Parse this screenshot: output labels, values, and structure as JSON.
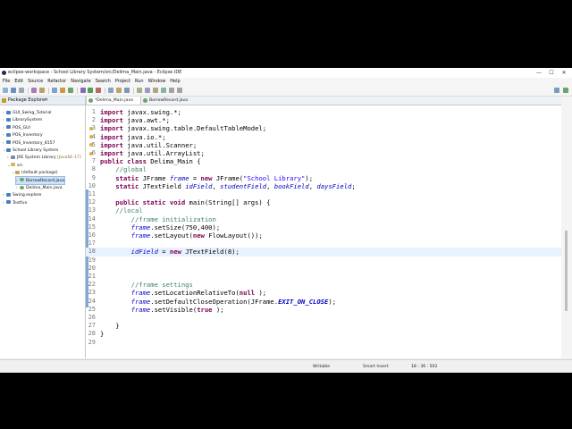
{
  "window": {
    "title": "eclipse-workspace - School Library System/src/Delima_Main.java - Eclipse IDE",
    "min_glyph": "—",
    "max_glyph": "☐",
    "close_glyph": "✕"
  },
  "menu": [
    "File",
    "Edit",
    "Source",
    "Refactor",
    "Navigate",
    "Search",
    "Project",
    "Run",
    "Window",
    "Help"
  ],
  "package_explorer": {
    "tab_label": "Package Explorer",
    "close_glyph": "✕",
    "tree": [
      {
        "label": "GUI_Swing_Tutorial",
        "suffix": "",
        "icon": "project-icon",
        "indent": 0,
        "twisty": "›",
        "selected": false
      },
      {
        "label": "LibrarySystem",
        "suffix": "",
        "icon": "project-icon",
        "indent": 0,
        "twisty": "›",
        "selected": false
      },
      {
        "label": "POS_GUI",
        "suffix": "",
        "icon": "project-icon",
        "indent": 0,
        "twisty": "›",
        "selected": false
      },
      {
        "label": "POS_Inventory",
        "suffix": "",
        "icon": "project-icon",
        "indent": 0,
        "twisty": "›",
        "selected": false
      },
      {
        "label": "POS_Inventory_8157",
        "suffix": "",
        "icon": "project-icon",
        "indent": 0,
        "twisty": "›",
        "selected": false
      },
      {
        "label": "School Library System",
        "suffix": "",
        "icon": "project-icon",
        "indent": 0,
        "twisty": "⌄",
        "selected": false
      },
      {
        "label": "JRE System Library",
        "suffix": " [JavaSE-17]",
        "icon": "library-icon",
        "indent": 1,
        "twisty": "›",
        "selected": false
      },
      {
        "label": "src",
        "suffix": "",
        "icon": "source-folder-icon",
        "indent": 1,
        "twisty": "⌄",
        "selected": false
      },
      {
        "label": "(default package)",
        "suffix": "",
        "icon": "package-icon",
        "indent": 2,
        "twisty": "⌄",
        "selected": false
      },
      {
        "label": "BorrowRecord.java",
        "suffix": "",
        "icon": "java-file-icon",
        "indent": 3,
        "twisty": "›",
        "selected": true
      },
      {
        "label": "Delima_Main.java",
        "suffix": "",
        "icon": "java-file-icon",
        "indent": 3,
        "twisty": "›",
        "selected": false
      },
      {
        "label": "Swing.explore",
        "suffix": "",
        "icon": "project-icon",
        "indent": 0,
        "twisty": "›",
        "selected": false
      },
      {
        "label": "Testfun",
        "suffix": "",
        "icon": "project-icon",
        "indent": 0,
        "twisty": "›",
        "selected": false
      }
    ]
  },
  "editor": {
    "tabs": [
      {
        "label": "*Delima_Main.java",
        "active": true
      },
      {
        "label": "BorrowRecord.java",
        "active": false
      }
    ],
    "current_line": 18,
    "lines": [
      {
        "n": "1",
        "marker": false,
        "tokens": [
          [
            "kw",
            "import"
          ],
          [
            "",
            "javax.swing.*;"
          ]
        ]
      },
      {
        "n": "2",
        "marker": false,
        "tokens": [
          [
            "kw",
            "import"
          ],
          [
            "",
            "java.awt.*;"
          ]
        ]
      },
      {
        "n": "3",
        "marker": true,
        "tokens": [
          [
            "kw",
            "import"
          ],
          [
            "",
            "javax.swing.table.DefaultTableModel;"
          ]
        ]
      },
      {
        "n": "4",
        "marker": true,
        "tokens": [
          [
            "kw",
            "import"
          ],
          [
            "",
            "java.io.*;"
          ]
        ]
      },
      {
        "n": "5",
        "marker": true,
        "tokens": [
          [
            "kw",
            "import"
          ],
          [
            "",
            "java.util.Scanner;"
          ]
        ]
      },
      {
        "n": "6",
        "marker": true,
        "tokens": [
          [
            "kw",
            "import"
          ],
          [
            "",
            "java.util.ArrayList;"
          ]
        ]
      },
      {
        "n": "7",
        "marker": false,
        "tokens": [
          [
            "kw",
            "public class"
          ],
          [
            "",
            "Delima_Main {"
          ]
        ]
      },
      {
        "n": "8",
        "marker": false,
        "tokens": [
          [
            "cm",
            "    //global"
          ]
        ]
      },
      {
        "n": "9",
        "marker": false,
        "tokens": [
          [
            "kw",
            "    static"
          ],
          [
            "",
            "JFrame "
          ],
          [
            "fd",
            "frame"
          ],
          [
            "",
            " = "
          ],
          [
            "kw",
            "new"
          ],
          [
            "",
            "JFrame("
          ],
          [
            "st",
            "\"School Library\""
          ],
          [
            "",
            ");"
          ]
        ]
      },
      {
        "n": "10",
        "marker": false,
        "tokens": [
          [
            "kw",
            "    static"
          ],
          [
            "",
            "JTextField "
          ],
          [
            "fd",
            "idField"
          ],
          [
            "",
            ", "
          ],
          [
            "fd",
            "studentField"
          ],
          [
            "",
            ", "
          ],
          [
            "fd",
            "bookField"
          ],
          [
            "",
            ", "
          ],
          [
            "fd",
            "daysField"
          ],
          [
            "",
            ";"
          ]
        ]
      },
      {
        "n": "11",
        "marker": false,
        "tokens": []
      },
      {
        "n": "12",
        "marker": false,
        "tokens": [
          [
            "kw",
            "    public static void"
          ],
          [
            "",
            "main(String[] args) {"
          ]
        ]
      },
      {
        "n": "13",
        "marker": false,
        "tokens": [
          [
            "cm",
            "    //local"
          ]
        ]
      },
      {
        "n": "14",
        "marker": false,
        "tokens": [
          [
            "cm",
            "        //frame initialization"
          ]
        ]
      },
      {
        "n": "15",
        "marker": false,
        "tokens": [
          [
            "fd",
            "        frame"
          ],
          [
            "",
            ".setSize(750,400);"
          ]
        ]
      },
      {
        "n": "16",
        "marker": false,
        "tokens": [
          [
            "fd",
            "        frame"
          ],
          [
            "",
            ".setLayout("
          ],
          [
            "kw",
            "new"
          ],
          [
            "",
            "FlowLayout());"
          ]
        ]
      },
      {
        "n": "17",
        "marker": false,
        "tokens": []
      },
      {
        "n": "18",
        "marker": false,
        "tokens": [
          [
            "fd",
            "        idField"
          ],
          [
            "",
            " = "
          ],
          [
            "kw",
            "new"
          ],
          [
            "",
            "JTextField(8);"
          ]
        ]
      },
      {
        "n": "19",
        "marker": false,
        "tokens": []
      },
      {
        "n": "20",
        "marker": false,
        "tokens": []
      },
      {
        "n": "21",
        "marker": false,
        "tokens": []
      },
      {
        "n": "22",
        "marker": false,
        "tokens": [
          [
            "cm",
            "        //frame settings"
          ]
        ]
      },
      {
        "n": "23",
        "marker": false,
        "tokens": [
          [
            "fd",
            "        frame"
          ],
          [
            "",
            ".setLocationRelativeTo("
          ],
          [
            "kw",
            "null"
          ],
          [
            "",
            ");"
          ]
        ]
      },
      {
        "n": "24",
        "marker": false,
        "tokens": [
          [
            "fd",
            "        frame"
          ],
          [
            "",
            ".setDefaultCloseOperation(JFrame."
          ],
          [
            "sf",
            "EXIT_ON_CLOSE"
          ],
          [
            "",
            ");"
          ]
        ]
      },
      {
        "n": "25",
        "marker": false,
        "tokens": [
          [
            "fd",
            "        frame"
          ],
          [
            "",
            ".setVisible("
          ],
          [
            "kw",
            "true"
          ],
          [
            "",
            ");"
          ]
        ]
      },
      {
        "n": "26",
        "marker": false,
        "tokens": []
      },
      {
        "n": "27",
        "marker": false,
        "tokens": [
          [
            "",
            "    }"
          ]
        ]
      },
      {
        "n": "28",
        "marker": false,
        "tokens": [
          [
            "",
            "}"
          ]
        ]
      },
      {
        "n": "29",
        "marker": false,
        "tokens": []
      }
    ]
  },
  "status": {
    "mode": "Writable",
    "insert": "Smart Insert",
    "position": "18 : 36 : 502"
  }
}
